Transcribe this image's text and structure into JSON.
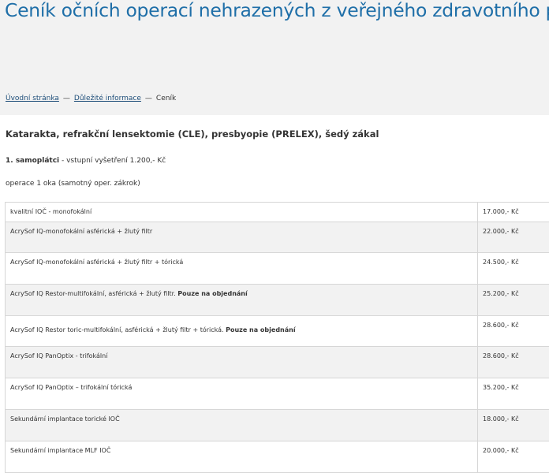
{
  "header": {
    "title": "Ceník očních operací nehrazených z veřejného zdravotního pojištění"
  },
  "breadcrumb": {
    "items": [
      "Úvodní stránka",
      "Důležité informace",
      "Ceník"
    ],
    "separator": "—"
  },
  "content": {
    "heading": "Katarakta, refrakční lensektomie (CLE), presbyopie (PRELEX), šedý zákal",
    "payer_label": "1. samoplátci",
    "payer_detail": " - vstupní vyšetření 1.200,- Kč",
    "operation_label": "operace 1 oka (samotný oper. zákrok)"
  },
  "price_table": {
    "rows": [
      {
        "name": "kvalitní IOČ - monofokální",
        "note": "",
        "price": "17.000,- Kč"
      },
      {
        "name": "AcrySof  IQ-monofokální asférická + žlutý filtr",
        "note": "",
        "price": "22.000,- Kč"
      },
      {
        "name": "AcrySof  IQ-monofokální asférická + žlutý filtr + tórická",
        "note": "",
        "price": "24.500,- Kč"
      },
      {
        "name": "AcrySof IQ Restor-multifokální, asférická + žlutý filtr. ",
        "note": "Pouze na objednání",
        "price": "25.200,- Kč"
      },
      {
        "name": "AcrySof IQ Restor toric-multifokální, asférická + žlutý filtr + tórická. ",
        "note": "Pouze na objednání",
        "price": "28.600,- Kč"
      },
      {
        "name": "AcrySof IQ PanOptix - trifokální",
        "note": "",
        "price": "28.600,- Kč"
      },
      {
        "name": "AcrySof IQ PanOptix – trifokální tórická",
        "note": "",
        "price": "35.200,- Kč"
      },
      {
        "name": "Sekundární implantace torické IOČ",
        "note": "",
        "price": "18.000,- Kč"
      },
      {
        "name": "Sekundární implantace MLF IOČ",
        "note": "",
        "price": "20.000,- Kč"
      }
    ]
  }
}
